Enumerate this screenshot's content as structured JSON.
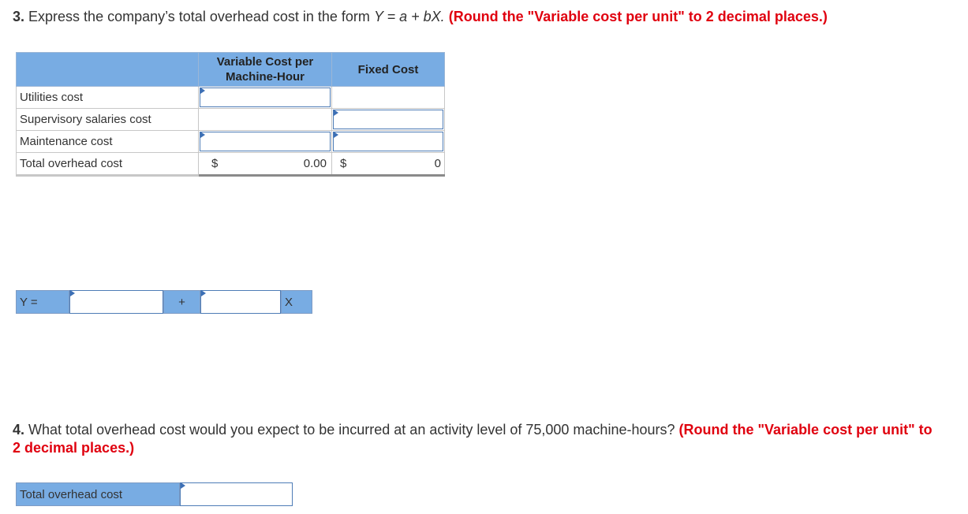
{
  "question3": {
    "number": "3.",
    "text": "Express the company’s total overhead cost in the form",
    "formula": "Y = a + bX.",
    "instruction": "(Round the \"Variable cost per unit\" to 2 decimal places.)"
  },
  "cost_table": {
    "headers": [
      "",
      "Variable Cost per Machine-Hour",
      "Fixed Cost"
    ],
    "header_line1": "Variable Cost per",
    "header_line2": "Machine-Hour",
    "rows": [
      {
        "label": "Utilities cost",
        "variable": "",
        "fixed": ""
      },
      {
        "label": "Supervisory salaries cost",
        "variable": "",
        "fixed": ""
      },
      {
        "label": "Maintenance cost",
        "variable": "",
        "fixed": ""
      }
    ],
    "total": {
      "label": "Total overhead cost",
      "currency": "$",
      "variable_total": "0.00",
      "fixed_total": "0"
    }
  },
  "equation": {
    "y_label": "Y =",
    "a_value": "",
    "plus": "+",
    "b_value": "",
    "x_label": "X"
  },
  "question4": {
    "number": "4.",
    "text": "What total overhead cost would you expect to be incurred at an activity level of 75,000 machine-hours?",
    "instruction": "(Round the \"Variable cost per unit\" to 2 decimal places.)"
  },
  "total_overhead": {
    "label": "Total overhead cost",
    "value": ""
  },
  "colors": {
    "header_blue": "#78ace3",
    "instruction_red": "#e0000f",
    "input_border": "#4e7cb6"
  }
}
